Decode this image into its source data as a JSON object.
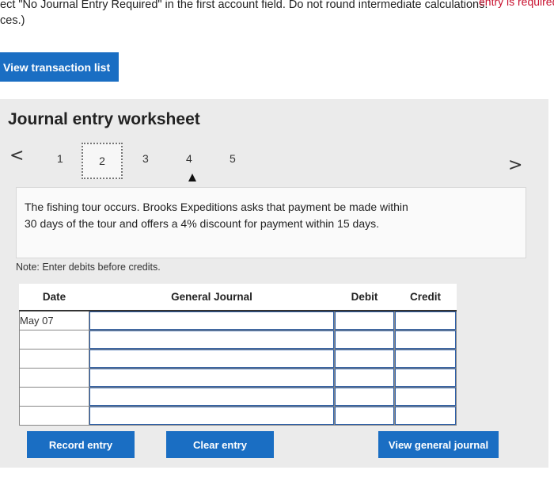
{
  "instructions": {
    "line1_prefix": "ect \"No Journal Entry Required\" in the first account field. Do not round intermediate calculations.",
    "line1_red": "entry is required fo",
    "line2": "ces.)"
  },
  "top_button": {
    "label": "View transaction list"
  },
  "worksheet": {
    "title": "Journal entry worksheet",
    "prev_arrow": "<",
    "next_arrow": ">",
    "pages": [
      "1",
      "2",
      "3",
      "4",
      "5"
    ],
    "active_page": "2"
  },
  "description": {
    "text_line1": "The fishing tour occurs. Brooks Expeditions asks that payment be made within",
    "text_line2": "30 days of the tour and offers a 4% discount for payment within 15 days."
  },
  "note": "Note: Enter debits before credits.",
  "table": {
    "headers": {
      "date": "Date",
      "general_journal": "General Journal",
      "debit": "Debit",
      "credit": "Credit"
    },
    "rows": [
      {
        "date": "May 07",
        "account": "",
        "debit": "",
        "credit": ""
      },
      {
        "date": "",
        "account": "",
        "debit": "",
        "credit": ""
      },
      {
        "date": "",
        "account": "",
        "debit": "",
        "credit": ""
      },
      {
        "date": "",
        "account": "",
        "debit": "",
        "credit": ""
      },
      {
        "date": "",
        "account": "",
        "debit": "",
        "credit": ""
      },
      {
        "date": "",
        "account": "",
        "debit": "",
        "credit": ""
      }
    ]
  },
  "buttons": {
    "record": "Record entry",
    "clear": "Clear entry",
    "view_journal": "View general journal"
  },
  "colors": {
    "button_blue": "#1a6ec3",
    "panel_gray": "#ebebeb",
    "red_text": "#c8102e"
  }
}
